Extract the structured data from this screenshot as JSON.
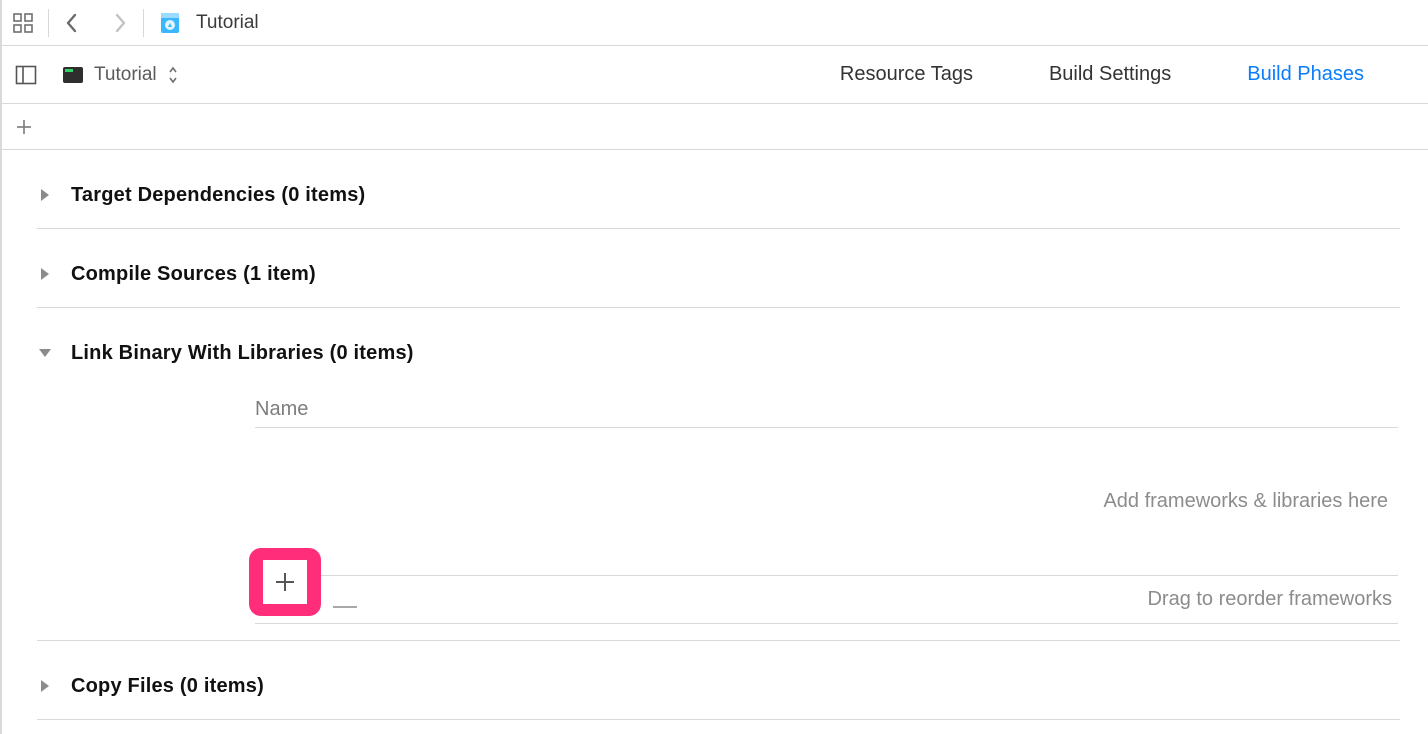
{
  "nav": {
    "title": "Tutorial"
  },
  "target": {
    "name": "Tutorial"
  },
  "tabs": {
    "resource_tags": "Resource Tags",
    "build_settings": "Build Settings",
    "build_phases": "Build Phases"
  },
  "phases": {
    "target_dependencies": {
      "title": "Target Dependencies (0 items)"
    },
    "compile_sources": {
      "title": "Compile Sources (1 item)"
    },
    "link_binary": {
      "title": "Link Binary With Libraries (0 items)",
      "col_name": "Name",
      "empty_hint": "Add frameworks & libraries here",
      "reorder_hint": "Drag to reorder frameworks"
    },
    "copy_files": {
      "title": "Copy Files (0 items)"
    }
  }
}
